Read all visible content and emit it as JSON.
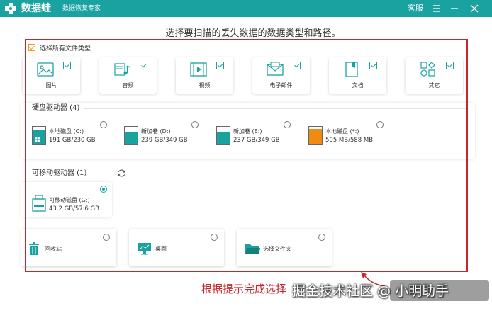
{
  "titlebar": {
    "app_name": "数据蛙",
    "app_subtitle": "数据恢复专家",
    "customer_service": "客服",
    "bg_color": "#1aa2a0"
  },
  "instruction": "选择要扫描的丢失数据的数据类型和路径。",
  "select_all": {
    "label": "选择所有文件类型",
    "checked": true
  },
  "file_types": [
    {
      "label": "图片",
      "icon": "image-icon",
      "checked": true
    },
    {
      "label": "音频",
      "icon": "music-icon",
      "checked": true
    },
    {
      "label": "视频",
      "icon": "video-icon",
      "checked": true
    },
    {
      "label": "电子邮件",
      "icon": "email-icon",
      "checked": true
    },
    {
      "label": "文档",
      "icon": "document-icon",
      "checked": true
    },
    {
      "label": "其它",
      "icon": "other-icon",
      "checked": true
    }
  ],
  "hard_drives": {
    "title": "硬盘驱动器 (4)",
    "items": [
      {
        "name": "本地磁盘 (C:)",
        "size": "191 GB/230 GB",
        "fill": 0.83,
        "color": "#1aa2a0"
      },
      {
        "name": "新加卷 (D:)",
        "size": "239 GB/349 GB",
        "fill": 0.68,
        "color": "#1aa2a0"
      },
      {
        "name": "新加卷 (E:)",
        "size": "237 GB/349 GB",
        "fill": 0.68,
        "color": "#1aa2a0"
      },
      {
        "name": "本地磁盘 (*:)",
        "size": "505 MB/588 MB",
        "fill": 0.86,
        "color": "#f08a12"
      }
    ]
  },
  "removable": {
    "title": "可移动驱动器 (1)",
    "refresh_icon": "refresh-icon",
    "items": [
      {
        "name": "可移动磁盘 (G:)",
        "size": "43.2 GB/57.6 GB",
        "selected": true
      }
    ]
  },
  "locations": [
    {
      "label": "回收站",
      "icon": "recycle-bin-icon"
    },
    {
      "label": "桌面",
      "icon": "desktop-icon"
    },
    {
      "label": "选择文件夹",
      "icon": "folder-icon"
    }
  ],
  "annotation": "根据提示完成选择",
  "watermark": "掘金技术社区 @ 小明助手",
  "accent_color": "#1aa2a0",
  "highlight_color": "#c9262b"
}
